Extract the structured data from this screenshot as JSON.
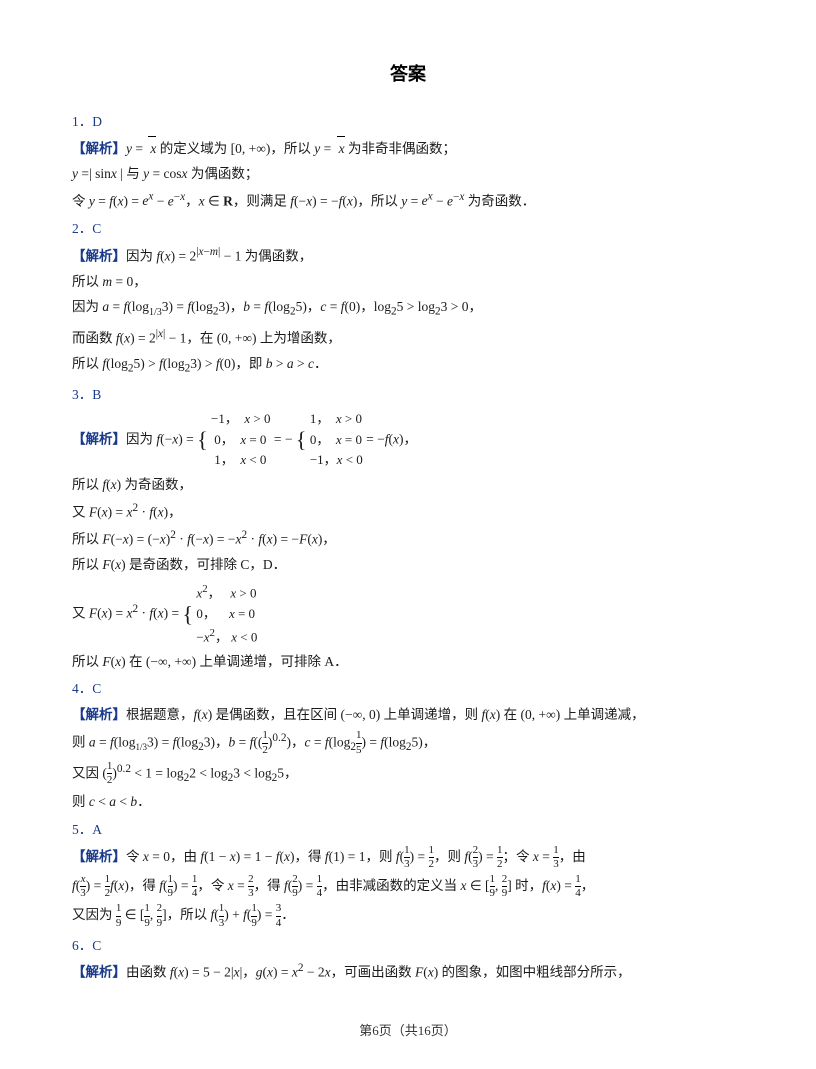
{
  "title": "答案",
  "footer": "第6页（共16页）",
  "problems": [
    {
      "number": "1.",
      "answer": "D",
      "analysis_label": "【解析】"
    }
  ]
}
